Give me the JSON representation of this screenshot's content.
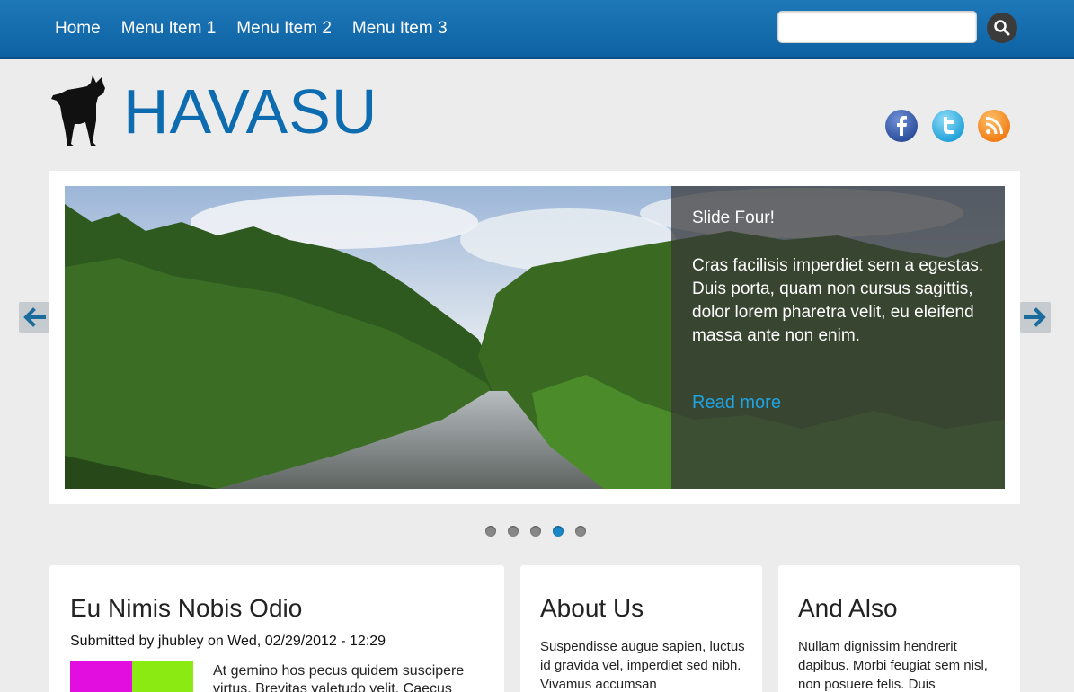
{
  "nav": {
    "items": [
      "Home",
      "Menu Item 1",
      "Menu Item 2",
      "Menu Item 3"
    ],
    "search_placeholder": ""
  },
  "header": {
    "site_title": "HAVASU",
    "social": [
      "facebook-icon",
      "twitter-icon",
      "rss-icon"
    ]
  },
  "slider": {
    "title": "Slide Four!",
    "text": "Cras facilisis imperdiet sem a egestas. Duis porta, quam non cursus sagittis, dolor lorem pharetra velit, eu eleifend massa ante non enim.",
    "read_more": "Read more",
    "slide_count": 5,
    "active_slide": 4
  },
  "main_post": {
    "title": "Eu Nimis Nobis Odio",
    "byline": "Submitted by jhubley on Wed, 02/29/2012 - 12:29",
    "teaser": "At gemino hos pecus quidem suscipere virtus. Brevitas valetudo velit. Caecus"
  },
  "about": {
    "title": "About Us",
    "text": "Suspendisse augue sapien, luctus id gravida vel, imperdiet sed nibh. Vivamus accumsan"
  },
  "also": {
    "title": "And Also",
    "text": "Nullam dignissim hendrerit dapibus. Morbi feugiat sem nisl, non posuere felis. Duis"
  },
  "colors": {
    "brand_blue": "#0d6cb0",
    "link_blue": "#1fa3e2",
    "topbar": "#1270b2"
  }
}
